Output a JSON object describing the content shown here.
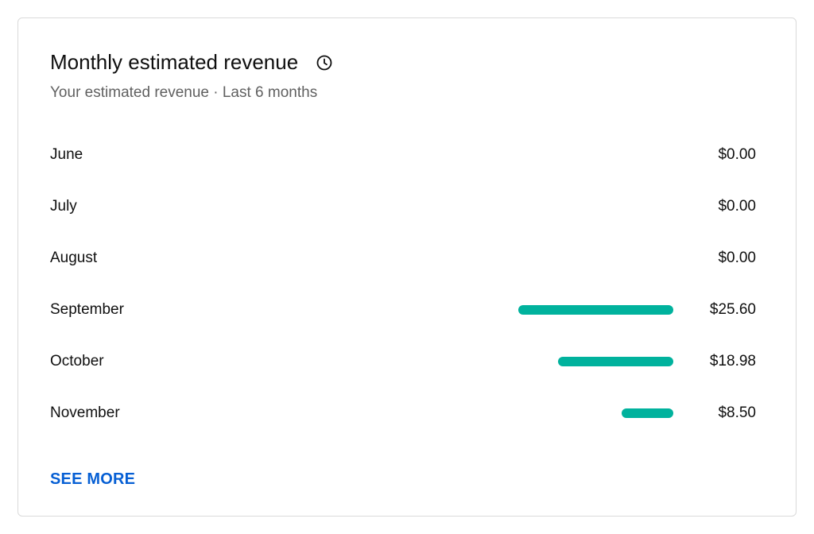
{
  "card": {
    "title": "Monthly estimated revenue",
    "info_icon": "clock-icon",
    "subtitle": "Your estimated revenue · Last 6 months",
    "see_more_label": "SEE MORE"
  },
  "colors": {
    "bar": "#00b29d",
    "link": "#065fd4",
    "text": "#0f0f0f",
    "muted": "#606060"
  },
  "rows": [
    {
      "month": "June",
      "revenue": "$0.00",
      "amount": 0
    },
    {
      "month": "July",
      "revenue": "$0.00",
      "amount": 0
    },
    {
      "month": "August",
      "revenue": "$0.00",
      "amount": 0
    },
    {
      "month": "September",
      "revenue": "$25.60",
      "amount": 25.6
    },
    {
      "month": "October",
      "revenue": "$18.98",
      "amount": 18.98
    },
    {
      "month": "November",
      "revenue": "$8.50",
      "amount": 8.5
    }
  ]
}
